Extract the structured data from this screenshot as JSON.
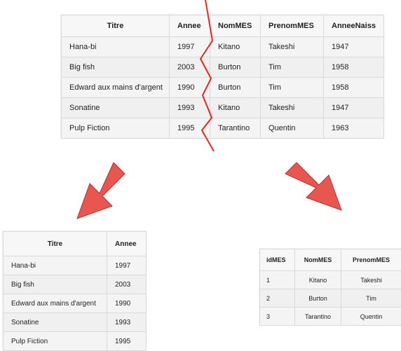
{
  "main_table": {
    "headers": [
      "Titre",
      "Annee",
      "NomMES",
      "PrenomMES",
      "AnneeNaiss"
    ],
    "rows": [
      [
        "Hana-bi",
        "1997",
        "Kitano",
        "Takeshi",
        "1947"
      ],
      [
        "Big fish",
        "2003",
        "Burton",
        "Tim",
        "1958"
      ],
      [
        "Edward aux mains d'argent",
        "1990",
        "Burton",
        "Tim",
        "1958"
      ],
      [
        "Sonatine",
        "1993",
        "Kitano",
        "Takeshi",
        "1947"
      ],
      [
        "Pulp Fiction",
        "1995",
        "Tarantino",
        "Quentin",
        "1963"
      ]
    ]
  },
  "left_table": {
    "headers": [
      "Titre",
      "Annee"
    ],
    "rows": [
      [
        "Hana-bi",
        "1997"
      ],
      [
        "Big fish",
        "2003"
      ],
      [
        "Edward aux mains d'argent",
        "1990"
      ],
      [
        "Sonatine",
        "1993"
      ],
      [
        "Pulp Fiction",
        "1995"
      ]
    ]
  },
  "right_table": {
    "headers": [
      "idMES",
      "NomMES",
      "PrenomMES"
    ],
    "rows": [
      [
        "1",
        "Kitano",
        "Takeshi"
      ],
      [
        "2",
        "Burton",
        "Tim"
      ],
      [
        "3",
        "Tarantino",
        "Quentin"
      ]
    ]
  },
  "colors": {
    "split_line": "#e8281e",
    "arrow_fill": "#e8564f",
    "arrow_stroke": "#b8302a"
  }
}
